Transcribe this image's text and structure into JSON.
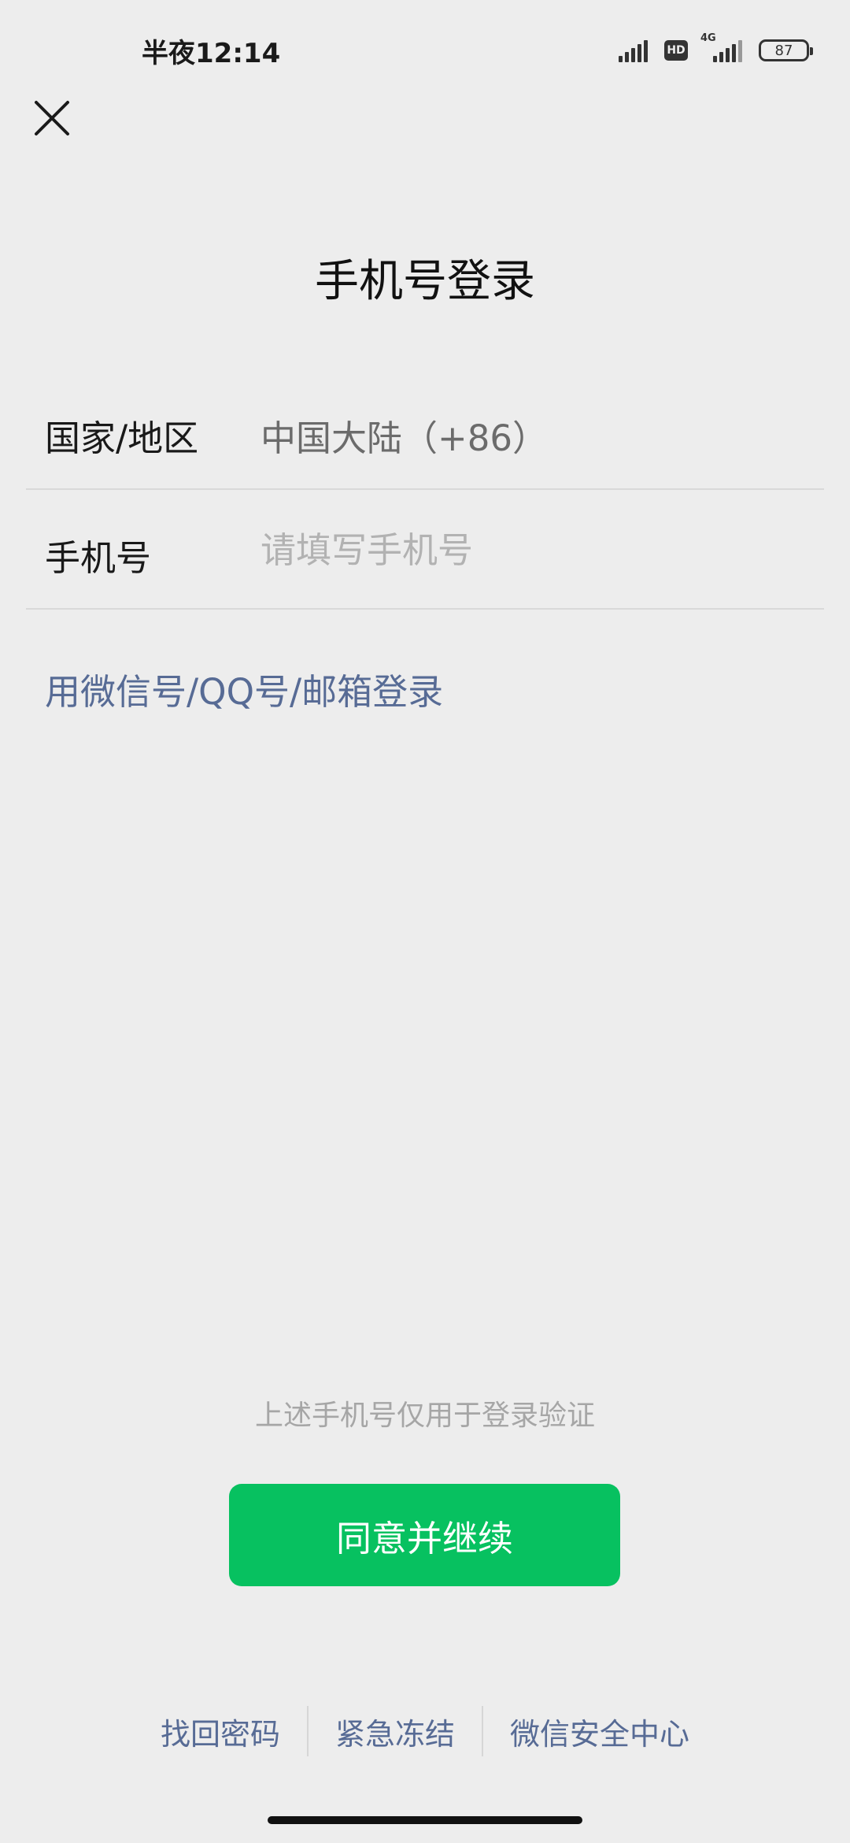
{
  "status_bar": {
    "time": "半夜12:14",
    "hd_label": "HD",
    "network_label": "4G",
    "battery_level": "87"
  },
  "header": {
    "close_icon": "close-icon"
  },
  "title": "手机号登录",
  "form": {
    "country": {
      "label": "国家/地区",
      "value": "中国大陆（+86）"
    },
    "phone": {
      "label": "手机号",
      "value": "",
      "placeholder": "请填写手机号"
    }
  },
  "alt_login_link": "用微信号/QQ号/邮箱登录",
  "notice": "上述手机号仅用于登录验证",
  "agree_button": "同意并继续",
  "footer": {
    "links": [
      "找回密码",
      "紧急冻结",
      "微信安全中心"
    ]
  },
  "colors": {
    "background": "#ededed",
    "primary_green": "#07c160",
    "link_blue": "#576b95"
  }
}
